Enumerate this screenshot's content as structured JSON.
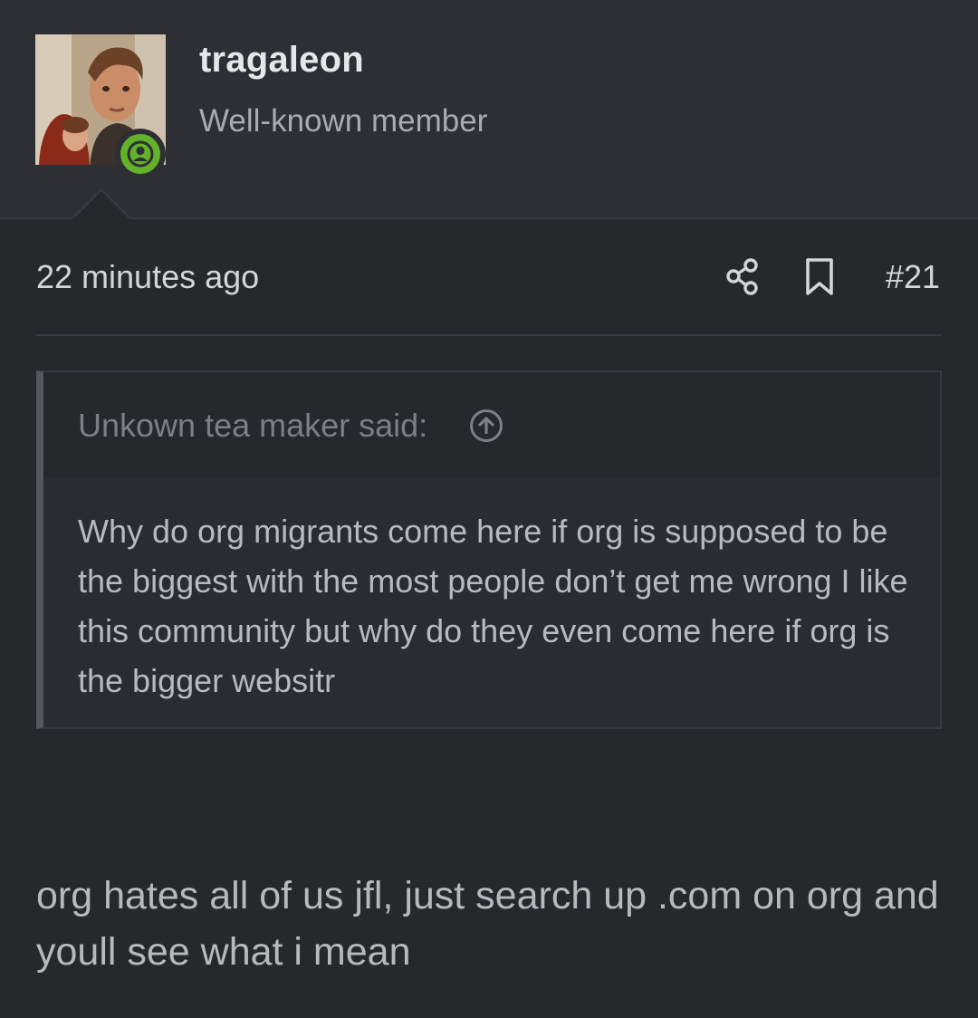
{
  "user": {
    "name": "tragaleon",
    "title": "Well-known member",
    "status": "online"
  },
  "post": {
    "timestamp": "22 minutes ago",
    "number": "#21",
    "actions": {
      "share_icon": "share-icon",
      "bookmark_icon": "bookmark-icon"
    }
  },
  "quote": {
    "author_line": "Unkown tea maker said:",
    "jump_icon": "arrow-up-circle-icon",
    "text": "Why do org migrants come here if org is supposed to be the biggest with the most people don’t get me wrong I like this community but why do they even come here if org is the bigger websitr"
  },
  "reply": {
    "text": "org hates all of us jfl, just search up .com on org and youll see what i mean"
  },
  "colors": {
    "background": "#27282c",
    "header_bg": "#2e2f34",
    "online_green": "#63b22a",
    "quote_bar": "#55575c"
  }
}
